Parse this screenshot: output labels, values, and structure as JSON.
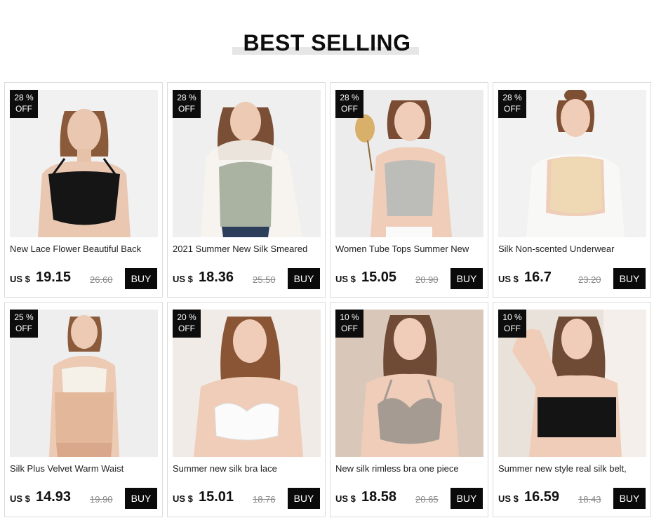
{
  "section": {
    "title": "BEST SELLING"
  },
  "products": [
    {
      "discount_pct": "28 %",
      "discount_off": "OFF",
      "title": "New Lace Flower Beautiful Back",
      "currency": "US $",
      "price": "19.15",
      "old_price": "26.60",
      "buy_label": "BUY",
      "image": "black-bra-model"
    },
    {
      "discount_pct": "28 %",
      "discount_off": "OFF",
      "title": "2021 Summer New Silk Smeared",
      "currency": "US $",
      "price": "18.36",
      "old_price": "25.50",
      "buy_label": "BUY",
      "image": "sage-lace-camisole-model"
    },
    {
      "discount_pct": "28 %",
      "discount_off": "OFF",
      "title": "Women Tube Tops Summer New",
      "currency": "US $",
      "price": "15.05",
      "old_price": "20.90",
      "buy_label": "BUY",
      "image": "silver-satin-camisole-model"
    },
    {
      "discount_pct": "28 %",
      "discount_off": "OFF",
      "title": "Silk Non-scented Underwear",
      "currency": "US $",
      "price": "16.7",
      "old_price": "23.20",
      "buy_label": "BUY",
      "image": "nude-bra-model"
    },
    {
      "discount_pct": "25 %",
      "discount_off": "OFF",
      "title": "Silk Plus Velvet Warm Waist",
      "currency": "US $",
      "price": "14.93",
      "old_price": "19.90",
      "buy_label": "BUY",
      "image": "waist-wrap-model"
    },
    {
      "discount_pct": "20 %",
      "discount_off": "OFF",
      "title": "Summer new silk bra lace",
      "currency": "US $",
      "price": "15.01",
      "old_price": "18.76",
      "buy_label": "BUY",
      "image": "white-lace-bra-model"
    },
    {
      "discount_pct": "10 %",
      "discount_off": "OFF",
      "title": "New silk rimless bra one piece",
      "currency": "US $",
      "price": "18.58",
      "old_price": "20.65",
      "buy_label": "BUY",
      "image": "taupe-bra-model"
    },
    {
      "discount_pct": "10 %",
      "discount_off": "OFF",
      "title": "Summer new style real silk belt,",
      "currency": "US $",
      "price": "16.59",
      "old_price": "18.43",
      "buy_label": "BUY",
      "image": "black-lace-bandeau-model"
    }
  ],
  "colors": {
    "badge": "#0d0d0d",
    "buy_button": "#0a0a0a",
    "heading_bar": "#e6e6e6"
  }
}
